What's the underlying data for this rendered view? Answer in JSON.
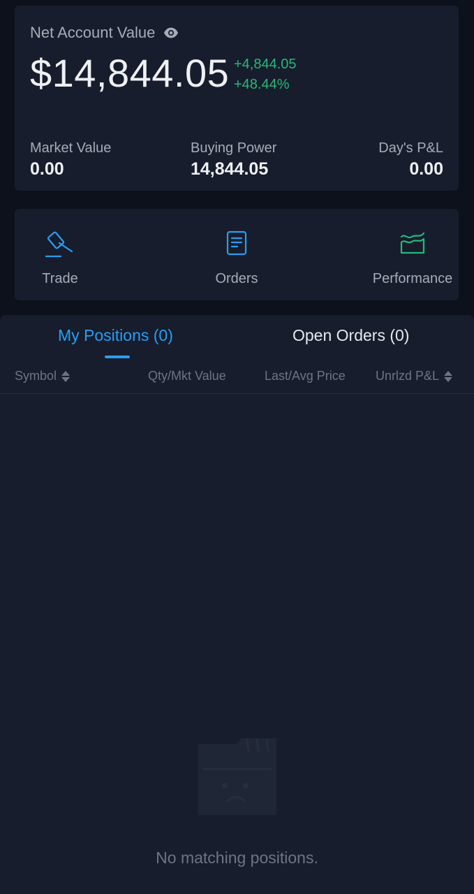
{
  "account": {
    "net_label": "Net Account Value",
    "net_value": "$14,844.05",
    "change_amount": "+4,844.05",
    "change_percent": "+48.44%",
    "stats": {
      "market_value": {
        "label": "Market Value",
        "value": "0.00"
      },
      "buying_power": {
        "label": "Buying Power",
        "value": "14,844.05"
      },
      "days_pnl": {
        "label": "Day's P&L",
        "value": "0.00"
      }
    }
  },
  "actions": [
    {
      "label": "Trade",
      "icon": "gavel-icon"
    },
    {
      "label": "Orders",
      "icon": "document-icon"
    },
    {
      "label": "Performance",
      "icon": "chart-area-icon"
    }
  ],
  "tabs": {
    "positions": "My Positions (0)",
    "orders": "Open Orders (0)"
  },
  "columns": {
    "symbol": "Symbol",
    "qty": "Qty/Mkt Value",
    "last": "Last/Avg Price",
    "pnl": "Unrlzd P&L"
  },
  "empty": {
    "message": "No matching positions.",
    "icon": "empty-folder-icon"
  },
  "colors": {
    "accent": "#2a9df0",
    "positive": "#28b87a",
    "background": "#0c111b",
    "card": "#171d2c"
  }
}
